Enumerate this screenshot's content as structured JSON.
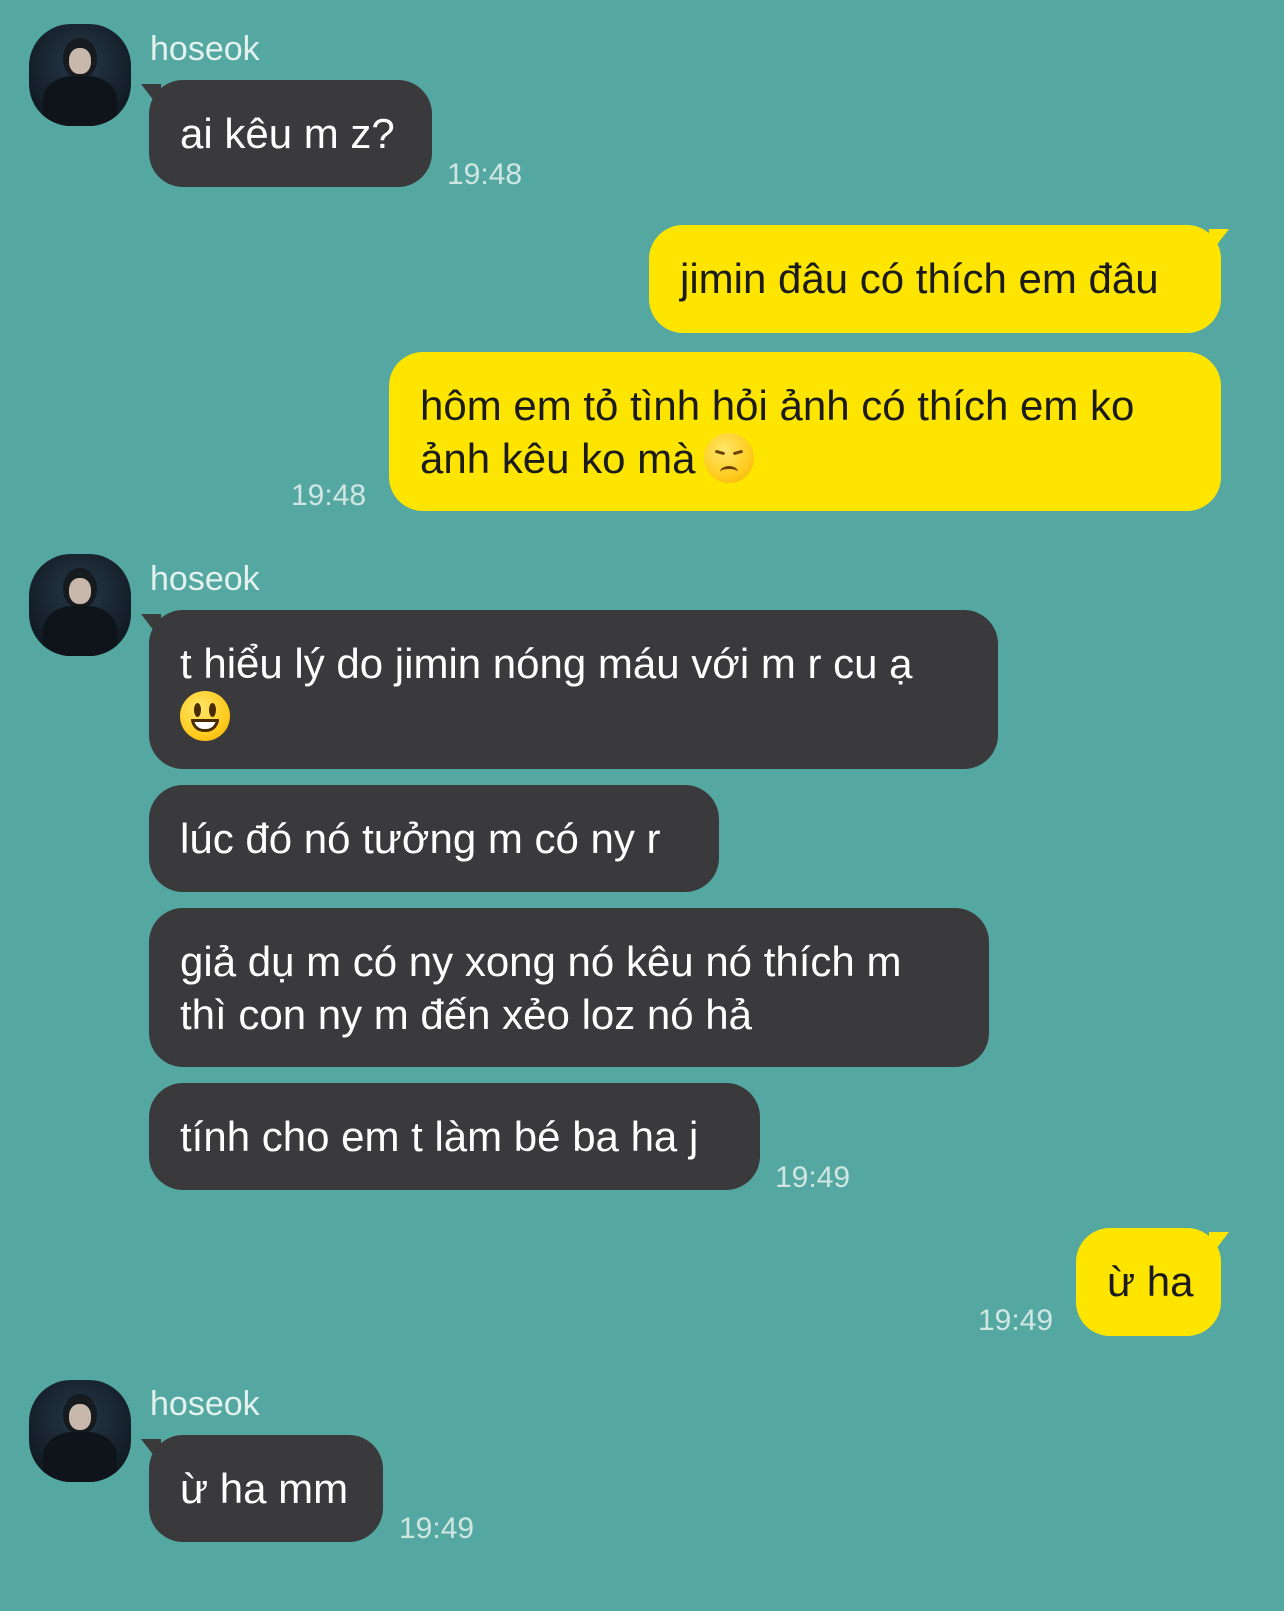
{
  "chat": {
    "groups": [
      {
        "sender": "hoseok",
        "messages": [
          "ai kêu m z?"
        ],
        "time": "19:48"
      },
      {
        "sender": "me",
        "messages": [
          "jimin đâu có thích em đâu",
          "hôm em tỏ tình hỏi ảnh có thích em ko",
          "ảnh kêu ko mà"
        ],
        "time": "19:48"
      },
      {
        "sender": "hoseok",
        "messages": [
          "t hiểu lý do jimin nóng máu với m r cu ạ",
          "lúc đó nó tưởng m có ny r",
          "giả dụ m có ny xong nó kêu nó thích m",
          "thì con ny m đến xẻo loz nó hả",
          "tính cho em t làm bé ba ha j"
        ],
        "time": "19:49"
      },
      {
        "sender": "me",
        "messages": [
          "ừ ha"
        ],
        "time": "19:49"
      },
      {
        "sender": "hoseok",
        "messages": [
          "ừ ha mm"
        ],
        "time": "19:49"
      }
    ]
  },
  "emojis": {
    "disappointed": "disappointed-face-icon",
    "smiley": "smiley-face-icon"
  },
  "colors": {
    "background": "#54a8a1",
    "incoming": "#3a3a3c",
    "outgoing": "#fee500"
  }
}
